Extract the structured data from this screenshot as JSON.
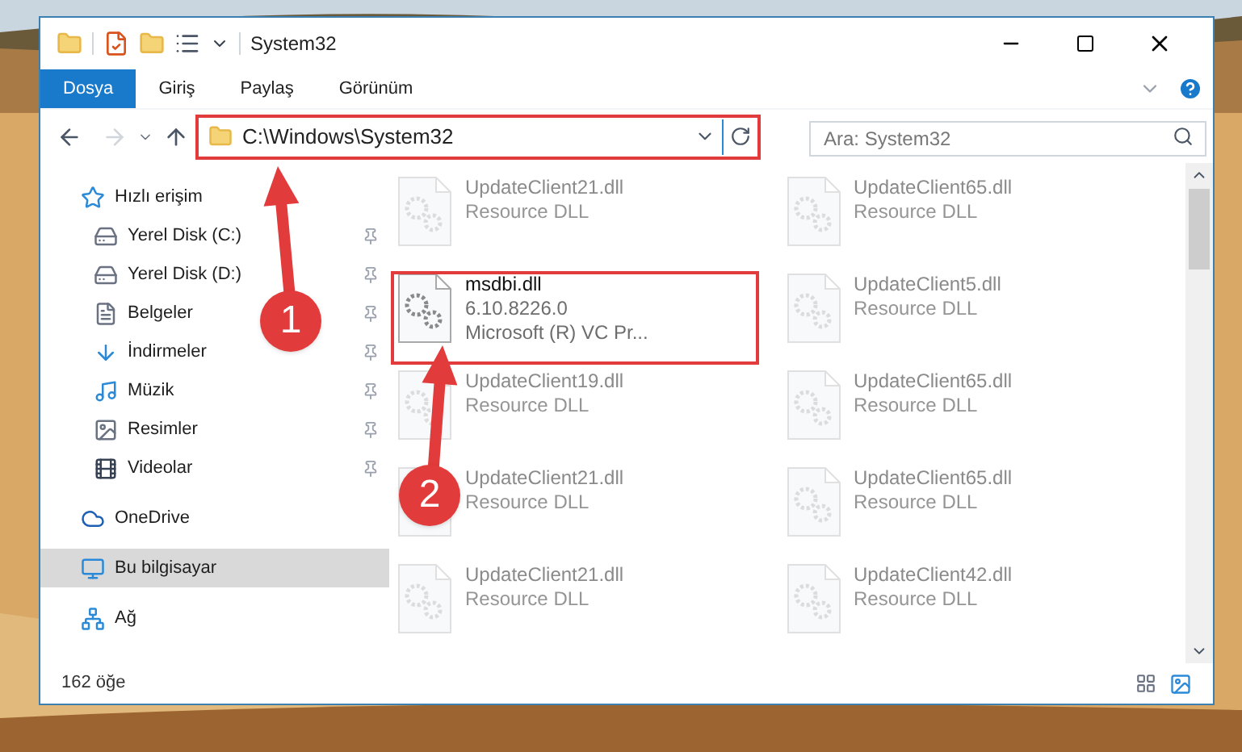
{
  "window": {
    "title": "System32"
  },
  "ribbon_tabs": [
    {
      "label": "Dosya",
      "selected": true
    },
    {
      "label": "Giriş",
      "selected": false
    },
    {
      "label": "Paylaş",
      "selected": false
    },
    {
      "label": "Görünüm",
      "selected": false
    }
  ],
  "address": {
    "value": "C:\\Windows\\System32"
  },
  "search": {
    "placeholder": "Ara: System32"
  },
  "sidebar": {
    "items": [
      {
        "label": "Hızlı erişim",
        "kind": "star",
        "selected": false,
        "children": [
          {
            "label": "Yerel Disk (C:)",
            "kind": "disk",
            "pinned": true
          },
          {
            "label": "Yerel Disk (D:)",
            "kind": "disk",
            "pinned": true
          },
          {
            "label": "Belgeler",
            "kind": "document",
            "pinned": true
          },
          {
            "label": "İndirmeler",
            "kind": "download",
            "pinned": true
          },
          {
            "label": "Müzik",
            "kind": "music",
            "pinned": true
          },
          {
            "label": "Resimler",
            "pinned": true
          },
          {
            "label": "Videolar",
            "kind": "video",
            "pinned": true
          }
        ]
      },
      {
        "label": "OneDrive",
        "kind": "cloud",
        "selected": false
      },
      {
        "label": "Bu bilgisayar",
        "kind": "computer",
        "selected": true
      },
      {
        "label": "Ağ",
        "kind": "network",
        "selected": false
      }
    ]
  },
  "files": [
    {
      "name": "UpdateClient21.dll",
      "lines": [
        "Resource DLL"
      ],
      "faded": true
    },
    {
      "name": "UpdateClient65.dll",
      "lines": [
        "Resource DLL"
      ],
      "faded": true
    },
    {
      "name": "msdbi.dll",
      "lines": [
        "6.10.8226.0",
        "Microsoft (R) VC Pr..."
      ],
      "faded": false
    },
    {
      "name": "UpdateClient5.dll",
      "lines": [
        "Resource DLL"
      ],
      "faded": true
    },
    {
      "name": "UpdateClient19.dll",
      "lines": [
        "Resource DLL"
      ],
      "faded": true
    },
    {
      "name": "UpdateClient65.dll",
      "lines": [
        "Resource DLL"
      ],
      "faded": true
    },
    {
      "name": "UpdateClient21.dll",
      "lines": [
        "Resource DLL"
      ],
      "faded": true
    },
    {
      "name": "UpdateClient65.dll",
      "lines": [
        "Resource DLL"
      ],
      "faded": true
    },
    {
      "name": "UpdateClient21.dll",
      "lines": [
        "Resource DLL"
      ],
      "faded": true
    },
    {
      "name": "UpdateClient42.dll",
      "lines": [
        "Resource DLL"
      ],
      "faded": true
    }
  ],
  "status_bar": {
    "count": "162 öğe"
  },
  "annotations": [
    {
      "label": "1"
    },
    {
      "label": "2"
    }
  ]
}
